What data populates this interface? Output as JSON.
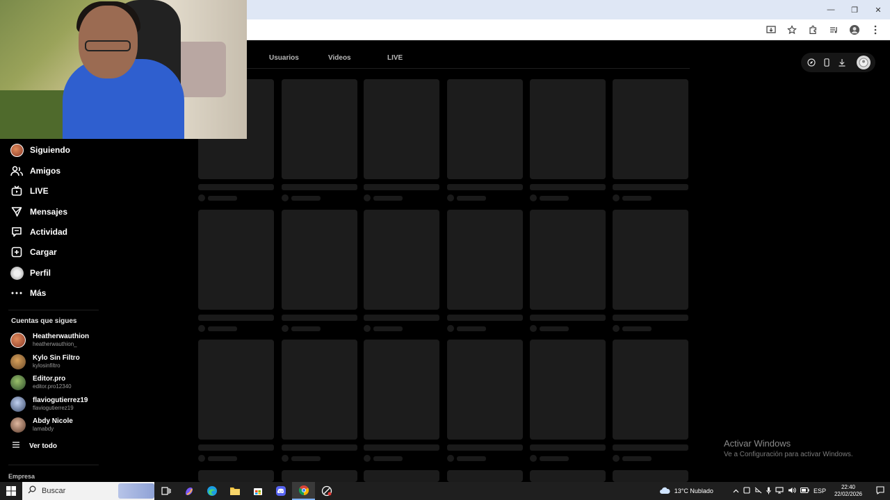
{
  "nav": {
    "items": [
      {
        "label": "Siguiendo"
      },
      {
        "label": "Amigos"
      },
      {
        "label": "LIVE"
      },
      {
        "label": "Mensajes"
      },
      {
        "label": "Actividad"
      },
      {
        "label": "Cargar"
      },
      {
        "label": "Perfil"
      },
      {
        "label": "Más"
      }
    ]
  },
  "following": {
    "title": "Cuentas que sigues",
    "accounts": [
      {
        "name": "Heatherwauthion",
        "handle": "heatherwauthion_",
        "color": "#c96a4a"
      },
      {
        "name": "Kylo Sin Filtro",
        "handle": "kylosinfiltro",
        "color": "#b07a3a"
      },
      {
        "name": "Editor.pro",
        "handle": "editor.pro12340",
        "color": "#4a7a3a"
      },
      {
        "name": "flaviogutierrez19",
        "handle": "flaviogutierrez19",
        "color": "#5a6a8a"
      },
      {
        "name": "Abdy Nicole",
        "handle": "lamabdy",
        "color": "#8a6a5a"
      }
    ],
    "see_all": "Ver todo"
  },
  "footer": {
    "company": "Empresa"
  },
  "tabs": [
    {
      "label": "Usuarios"
    },
    {
      "label": "Videos"
    },
    {
      "label": "LIVE"
    }
  ],
  "watermark": {
    "title": "Activar Windows",
    "subtitle": "Ve a Configuración para activar Windows."
  },
  "taskbar": {
    "search_label": "Buscar",
    "weather": "13°C  Nublado",
    "language": "ESP",
    "time": "22:40",
    "date": "22/02/2026"
  },
  "colors": {
    "background": "#000000",
    "skeleton": "#1c1c1c",
    "taskbar": "#1f1f1f",
    "chrome_bar": "#dfe7f5"
  }
}
